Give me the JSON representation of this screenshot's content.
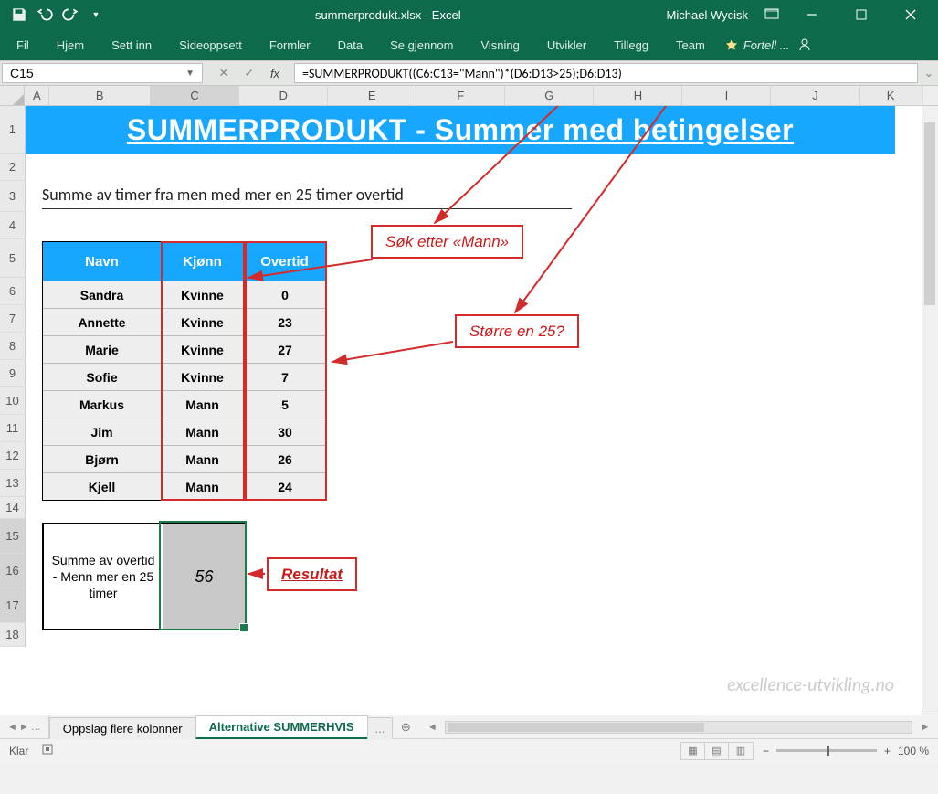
{
  "window": {
    "filename": "summerprodukt.xlsx - Excel",
    "user": "Michael Wycisk"
  },
  "tabs": [
    "Fil",
    "Hjem",
    "Sett inn",
    "Sideoppsett",
    "Formler",
    "Data",
    "Se gjennom",
    "Visning",
    "Utvikler",
    "Tillegg",
    "Team"
  ],
  "tell_me": "Fortell ...",
  "namebox": "C15",
  "formula": "=SUMMERPRODUKT((C6:C13=\"Mann\")*(D6:D13>25);D6:D13)",
  "columns": [
    "A",
    "B",
    "C",
    "D",
    "E",
    "F",
    "G",
    "H",
    "I",
    "J",
    "K"
  ],
  "rows": [
    "1",
    "2",
    "3",
    "4",
    "5",
    "6",
    "7",
    "8",
    "9",
    "10",
    "11",
    "12",
    "13",
    "14",
    "15",
    "16",
    "17",
    "18"
  ],
  "banner": "SUMMERPRODUKT - Summer med betingelser",
  "subtitle": "Summe av timer fra men med mer en 25 timer overtid",
  "table": {
    "headers": [
      "Navn",
      "Kjønn",
      "Overtid"
    ],
    "rows": [
      [
        "Sandra",
        "Kvinne",
        "0"
      ],
      [
        "Annette",
        "Kvinne",
        "23"
      ],
      [
        "Marie",
        "Kvinne",
        "27"
      ],
      [
        "Sofie",
        "Kvinne",
        "7"
      ],
      [
        "Markus",
        "Mann",
        "5"
      ],
      [
        "Jim",
        "Mann",
        "30"
      ],
      [
        "Bjørn",
        "Mann",
        "26"
      ],
      [
        "Kjell",
        "Mann",
        "24"
      ]
    ]
  },
  "result": {
    "label": "Summe av overtid - Menn mer en 25 timer",
    "value": "56"
  },
  "callouts": {
    "c1": "Søk etter «Mann»",
    "c2": "Større en 25?",
    "c3": "Resultat"
  },
  "watermark": "excellence-utvikling.no",
  "sheets": {
    "prev": "Oppslag flere kolonner",
    "active": "Alternative SUMMERHVIS",
    "dots": "..."
  },
  "status": {
    "ready": "Klar",
    "zoom": "100 %"
  }
}
